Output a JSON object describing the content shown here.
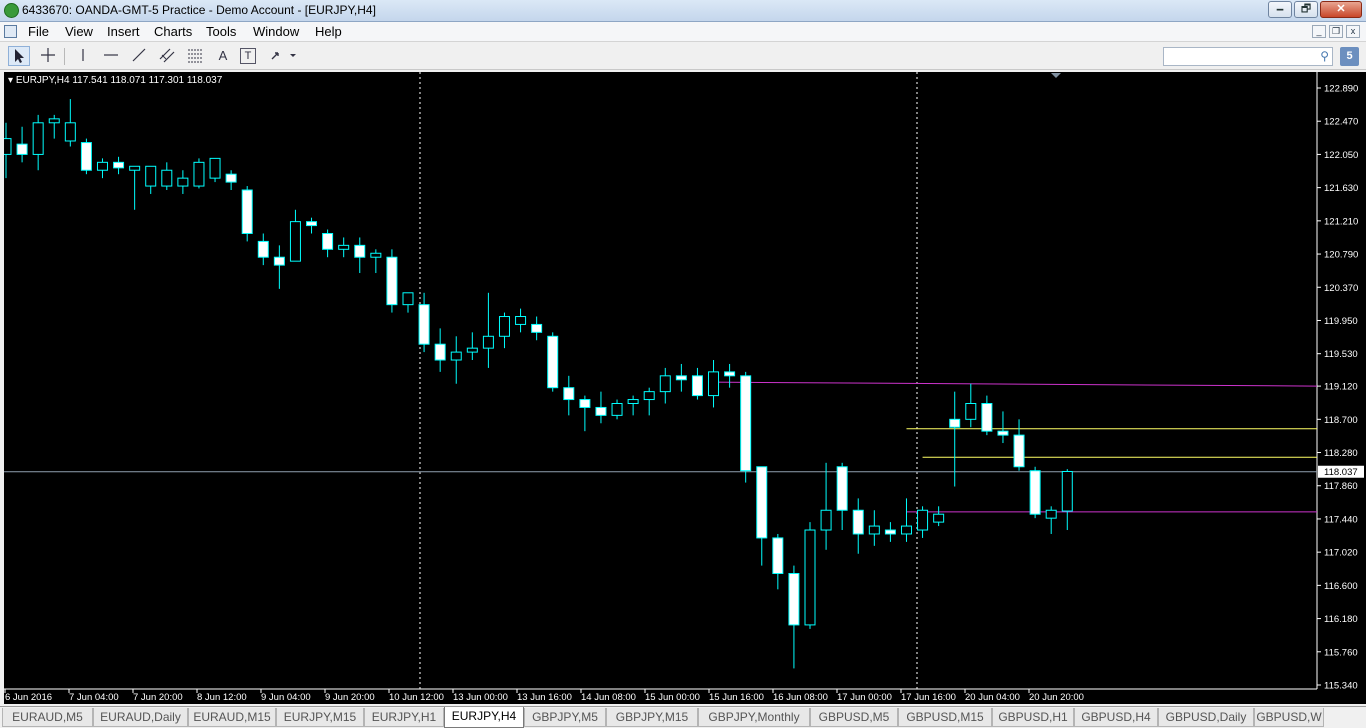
{
  "window": {
    "title": "6433670: OANDA-GMT-5 Practice - Demo Account - [EURJPY,H4]",
    "minimize": "🗕",
    "maximize": "🗗",
    "close": "✕"
  },
  "menu": {
    "items": [
      "File",
      "View",
      "Insert",
      "Charts",
      "Tools",
      "Window",
      "Help"
    ]
  },
  "toolbar": {
    "icons": [
      "cursor-icon",
      "crosshair-icon",
      "vertical-line-icon",
      "horizontal-line-icon",
      "trendline-icon",
      "equidistant-channel-icon",
      "fibonacci-icon",
      "text-icon",
      "text-label-icon",
      "arrows-icon"
    ],
    "text_tool": "A",
    "label_tool": "T",
    "search_placeholder": "",
    "notifications": "5"
  },
  "chart": {
    "symbol_info": "EURJPY,H4  117.541 118.071 117.301 118.037",
    "current_price": "118.037",
    "colors": {
      "background": "#000000",
      "candle": "#00ffff",
      "bull_body": "#000000",
      "bear_body": "#ffffff",
      "magenta_line": "#cc33cc",
      "yellow_line": "#ffff66",
      "grid_text": "#ffffff"
    },
    "price_labels": [
      "122.890",
      "122.470",
      "122.050",
      "121.630",
      "121.210",
      "120.790",
      "120.370",
      "119.950",
      "119.530",
      "119.120",
      "118.700",
      "118.280",
      "117.860",
      "117.440",
      "117.020",
      "116.600",
      "116.180",
      "115.760",
      "115.340"
    ],
    "time_labels": [
      "6 Jun 2016",
      "7 Jun 04:00",
      "7 Jun 20:00",
      "8 Jun 12:00",
      "9 Jun 04:00",
      "9 Jun 20:00",
      "10 Jun 12:00",
      "13 Jun 00:00",
      "13 Jun 16:00",
      "14 Jun 08:00",
      "15 Jun 00:00",
      "15 Jun 16:00",
      "16 Jun 08:00",
      "17 Jun 00:00",
      "17 Jun 16:00",
      "20 Jun 04:00",
      "20 Jun 20:00"
    ]
  },
  "chart_data": {
    "type": "candlestick",
    "symbol": "EURJPY",
    "timeframe": "H4",
    "ylim": [
      115.34,
      122.89
    ],
    "ohlc": [
      [
        122.05,
        122.45,
        121.75,
        122.25
      ],
      [
        122.18,
        122.4,
        121.95,
        122.05
      ],
      [
        122.05,
        122.55,
        121.85,
        122.45
      ],
      [
        122.45,
        122.55,
        122.25,
        122.5
      ],
      [
        122.22,
        122.75,
        122.15,
        122.45
      ],
      [
        122.2,
        122.25,
        121.8,
        121.85
      ],
      [
        121.85,
        122.0,
        121.75,
        121.95
      ],
      [
        121.95,
        122.02,
        121.8,
        121.88
      ],
      [
        121.85,
        121.9,
        121.35,
        121.9
      ],
      [
        121.65,
        121.9,
        121.55,
        121.9
      ],
      [
        121.65,
        121.95,
        121.6,
        121.85
      ],
      [
        121.65,
        121.85,
        121.55,
        121.75
      ],
      [
        121.65,
        122.0,
        121.62,
        121.95
      ],
      [
        121.75,
        122.0,
        121.7,
        122.0
      ],
      [
        121.8,
        121.85,
        121.6,
        121.7
      ],
      [
        121.6,
        121.65,
        120.95,
        121.05
      ],
      [
        120.95,
        121.05,
        120.65,
        120.75
      ],
      [
        120.75,
        120.9,
        120.35,
        120.65
      ],
      [
        120.7,
        121.35,
        120.7,
        121.2
      ],
      [
        121.2,
        121.25,
        121.05,
        121.15
      ],
      [
        121.05,
        121.1,
        120.75,
        120.85
      ],
      [
        120.85,
        121.0,
        120.75,
        120.9
      ],
      [
        120.9,
        121.0,
        120.55,
        120.75
      ],
      [
        120.75,
        120.85,
        120.55,
        120.8
      ],
      [
        120.75,
        120.85,
        120.05,
        120.15
      ],
      [
        120.15,
        120.3,
        120.05,
        120.3
      ],
      [
        120.15,
        120.3,
        119.55,
        119.65
      ],
      [
        119.65,
        119.85,
        119.3,
        119.45
      ],
      [
        119.45,
        119.75,
        119.15,
        119.55
      ],
      [
        119.55,
        119.8,
        119.45,
        119.6
      ],
      [
        119.6,
        120.3,
        119.35,
        119.75
      ],
      [
        119.75,
        120.05,
        119.6,
        120.0
      ],
      [
        119.9,
        120.1,
        119.8,
        120.0
      ],
      [
        119.9,
        120.0,
        119.7,
        119.8
      ],
      [
        119.75,
        119.8,
        119.05,
        119.1
      ],
      [
        119.1,
        119.25,
        118.75,
        118.95
      ],
      [
        118.95,
        119.0,
        118.55,
        118.85
      ],
      [
        118.85,
        119.05,
        118.65,
        118.75
      ],
      [
        118.75,
        118.95,
        118.7,
        118.9
      ],
      [
        118.9,
        119.0,
        118.75,
        118.95
      ],
      [
        118.95,
        119.1,
        118.75,
        119.05
      ],
      [
        119.05,
        119.35,
        118.9,
        119.25
      ],
      [
        119.25,
        119.4,
        119.05,
        119.2
      ],
      [
        119.25,
        119.35,
        118.95,
        119.0
      ],
      [
        119.0,
        119.45,
        118.85,
        119.3
      ],
      [
        119.3,
        119.4,
        119.1,
        119.25
      ],
      [
        119.25,
        119.3,
        117.9,
        118.05
      ],
      [
        118.1,
        118.1,
        116.85,
        117.2
      ],
      [
        117.2,
        117.25,
        116.55,
        116.75
      ],
      [
        116.75,
        116.85,
        115.55,
        116.1
      ],
      [
        116.1,
        117.4,
        116.05,
        117.3
      ],
      [
        117.3,
        118.15,
        117.05,
        117.55
      ],
      [
        118.1,
        118.15,
        117.3,
        117.55
      ],
      [
        117.55,
        117.7,
        117.0,
        117.25
      ],
      [
        117.25,
        117.55,
        117.1,
        117.35
      ],
      [
        117.3,
        117.4,
        117.15,
        117.25
      ],
      [
        117.25,
        117.7,
        117.15,
        117.35
      ],
      [
        117.3,
        117.6,
        117.2,
        117.55
      ],
      [
        117.4,
        117.6,
        117.35,
        117.5
      ],
      [
        118.7,
        119.05,
        117.85,
        118.6
      ],
      [
        118.7,
        119.15,
        118.6,
        118.9
      ],
      [
        118.9,
        119.0,
        118.5,
        118.55
      ],
      [
        118.55,
        118.8,
        118.4,
        118.5
      ],
      [
        118.5,
        118.7,
        118.05,
        118.1
      ],
      [
        118.05,
        118.1,
        117.45,
        117.5
      ],
      [
        117.45,
        117.6,
        117.25,
        117.55
      ],
      [
        117.54,
        118.07,
        117.3,
        118.04
      ]
    ],
    "current_price": 118.037,
    "levels": [
      {
        "color": "magenta",
        "price_start": 119.17,
        "price_end": 119.12
      },
      {
        "color": "yellow",
        "price": 118.58
      },
      {
        "color": "yellow",
        "price": 118.22
      },
      {
        "color": "magenta",
        "price": 117.53
      }
    ]
  },
  "tabs": [
    "EURAUD,M5",
    "EURAUD,Daily",
    "EURAUD,M15",
    "EURJPY,M15",
    "EURJPY,H1",
    "EURJPY,H4",
    "GBPJPY,M5",
    "GBPJPY,M15",
    "GBPJPY,Monthly",
    "GBPUSD,M5",
    "GBPUSD,M15",
    "GBPUSD,H1",
    "GBPUSD,H4",
    "GBPUSD,Daily",
    "GBPUSD,W"
  ],
  "active_tab": "EURJPY,H4"
}
